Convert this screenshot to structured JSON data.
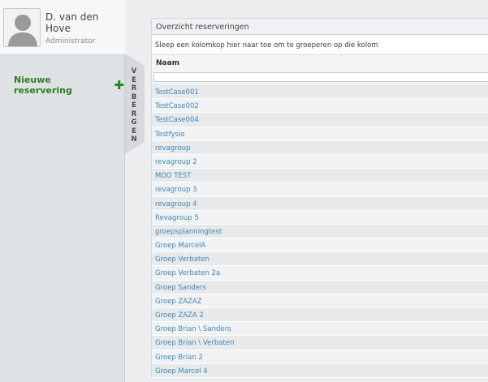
{
  "user": {
    "name": "D. van den Hove",
    "role": "Administrator"
  },
  "sidebar": {
    "new_reservation_label": "Nieuwe reservering",
    "plus_symbol": "✚",
    "hide_tab_letters": [
      "V",
      "E",
      "R",
      "B",
      "E",
      "R",
      "G",
      "E",
      "N"
    ]
  },
  "panel": {
    "title": "Overzicht reserveringen",
    "group_hint": "Sleep een kolomkop hier naar toe om te groeperen op die kolom",
    "column_header": "Naam"
  },
  "rows": [
    "TestCase001",
    "TestCase002",
    "TestCase004",
    "Testfysio",
    "revagroup",
    "revagroup 2",
    "MDO TEST",
    "revagroup 3",
    "revagroup 4",
    "Revagroup 5",
    "groepsplanningtest",
    "Groep MarcelA",
    "Groep Verbaten",
    "Groep Verbaten 2a",
    "Groep Sanders",
    "Groep ZAZAZ",
    "Groep ZAZA 2",
    "Groep Brian \\ Sanders",
    "Groep Brian \\ Verbaten",
    "Groep Brian 2",
    "Groep Marcel 4"
  ],
  "colors": {
    "link": "#3f86b4",
    "accent_green": "#2e7d1f"
  }
}
